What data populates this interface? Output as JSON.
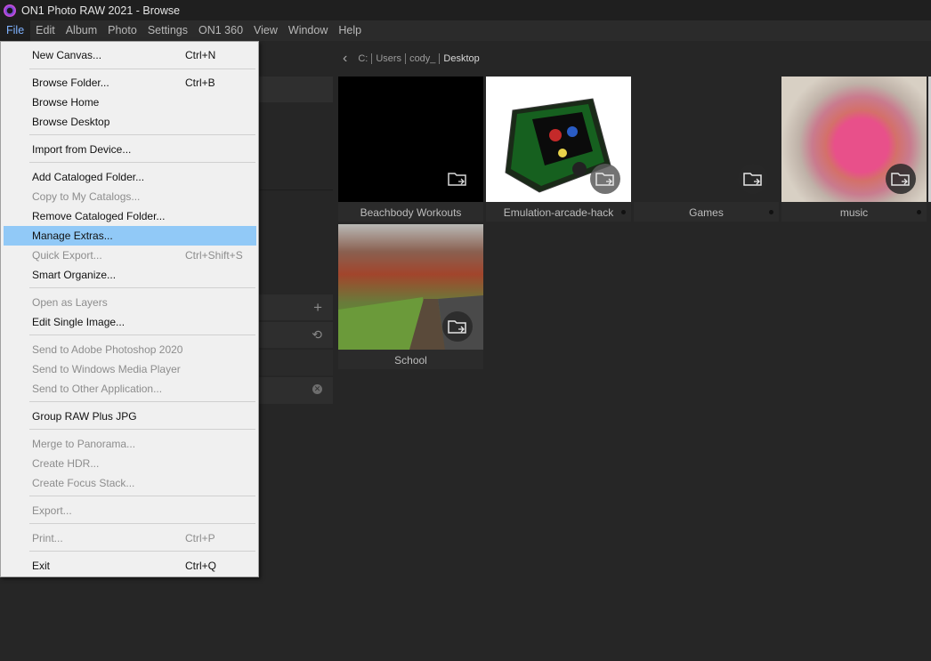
{
  "window": {
    "title": "ON1 Photo RAW 2021 - Browse"
  },
  "menubar": [
    "File",
    "Edit",
    "Album",
    "Photo",
    "Settings",
    "ON1 360",
    "View",
    "Window",
    "Help"
  ],
  "breadcrumb": [
    "C:",
    "Users",
    "cody_",
    "Desktop"
  ],
  "file_menu": [
    {
      "label": "New Canvas...",
      "shortcut": "Ctrl+N",
      "enabled": true
    },
    {
      "label": "Browse Folder...",
      "shortcut": "Ctrl+B",
      "enabled": true
    },
    {
      "label": "Browse Home",
      "shortcut": "",
      "enabled": true
    },
    {
      "label": "Browse Desktop",
      "shortcut": "",
      "enabled": true
    },
    {
      "label": "Import from Device...",
      "shortcut": "",
      "enabled": true
    },
    {
      "label": "Add Cataloged Folder...",
      "shortcut": "",
      "enabled": true
    },
    {
      "label": "Copy to My Catalogs...",
      "shortcut": "",
      "enabled": false
    },
    {
      "label": "Remove Cataloged Folder...",
      "shortcut": "",
      "enabled": true
    },
    {
      "label": "Manage Extras...",
      "shortcut": "",
      "enabled": true,
      "highlighted": true
    },
    {
      "label": "Quick Export...",
      "shortcut": "Ctrl+Shift+S",
      "enabled": false
    },
    {
      "label": "Smart Organize...",
      "shortcut": "",
      "enabled": true
    },
    {
      "label": "Open as Layers",
      "shortcut": "",
      "enabled": false
    },
    {
      "label": "Edit Single Image...",
      "shortcut": "",
      "enabled": true
    },
    {
      "label": "Send to Adobe Photoshop 2020",
      "shortcut": "",
      "enabled": false
    },
    {
      "label": "Send to Windows Media Player",
      "shortcut": "",
      "enabled": false
    },
    {
      "label": "Send to Other Application...",
      "shortcut": "",
      "enabled": false
    },
    {
      "label": "Group RAW Plus JPG",
      "shortcut": "",
      "enabled": true
    },
    {
      "label": "Merge to Panorama...",
      "shortcut": "",
      "enabled": false
    },
    {
      "label": "Create HDR...",
      "shortcut": "",
      "enabled": false
    },
    {
      "label": "Create Focus Stack...",
      "shortcut": "",
      "enabled": false
    },
    {
      "label": "Export...",
      "shortcut": "",
      "enabled": false
    },
    {
      "label": "Print...",
      "shortcut": "Ctrl+P",
      "enabled": false
    },
    {
      "label": "Exit",
      "shortcut": "Ctrl+Q",
      "enabled": true
    }
  ],
  "folders": [
    {
      "name": "Beachbody Workouts"
    },
    {
      "name": "Emulation-arcade-hack"
    },
    {
      "name": "Games"
    },
    {
      "name": "music"
    },
    {
      "name": "School"
    }
  ],
  "colors": {
    "menu_highlight": "#91c9f7",
    "active_menu_text": "#7fb2ff",
    "background": "#262626"
  }
}
